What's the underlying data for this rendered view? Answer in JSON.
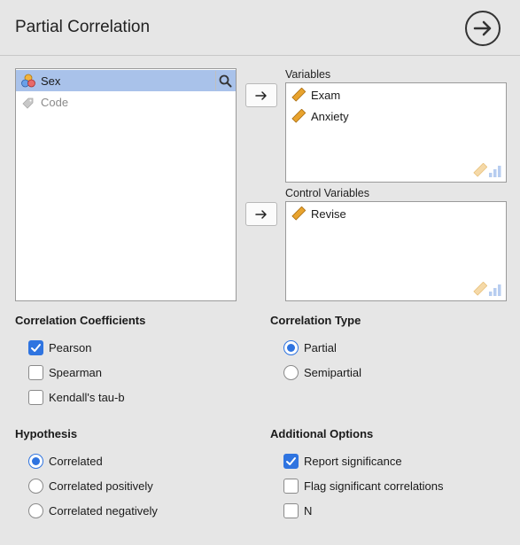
{
  "header": {
    "title": "Partial Correlation"
  },
  "source": {
    "items": [
      {
        "label": "Sex",
        "type": "nominal",
        "selected": true
      },
      {
        "label": "Code",
        "type": "id",
        "selected": false
      }
    ]
  },
  "variables": {
    "label": "Variables",
    "items": [
      {
        "label": "Exam"
      },
      {
        "label": "Anxiety"
      }
    ]
  },
  "control": {
    "label": "Control Variables",
    "items": [
      {
        "label": "Revise"
      }
    ]
  },
  "corr_coef": {
    "title": "Correlation Coefficients",
    "options": [
      {
        "label": "Pearson",
        "checked": true
      },
      {
        "label": "Spearman",
        "checked": false
      },
      {
        "label": "Kendall's tau-b",
        "checked": false
      }
    ]
  },
  "corr_type": {
    "title": "Correlation Type",
    "options": [
      {
        "label": "Partial",
        "selected": true
      },
      {
        "label": "Semipartial",
        "selected": false
      }
    ]
  },
  "hypothesis": {
    "title": "Hypothesis",
    "options": [
      {
        "label": "Correlated",
        "selected": true
      },
      {
        "label": "Correlated positively",
        "selected": false
      },
      {
        "label": "Correlated negatively",
        "selected": false
      }
    ]
  },
  "additional": {
    "title": "Additional Options",
    "options": [
      {
        "label": "Report significance",
        "checked": true
      },
      {
        "label": "Flag significant correlations",
        "checked": false
      },
      {
        "label": "N",
        "checked": false
      }
    ]
  },
  "colors": {
    "accent": "#2f74e0",
    "selection": "#a9c2ea",
    "ruler": "#e8a32e"
  }
}
